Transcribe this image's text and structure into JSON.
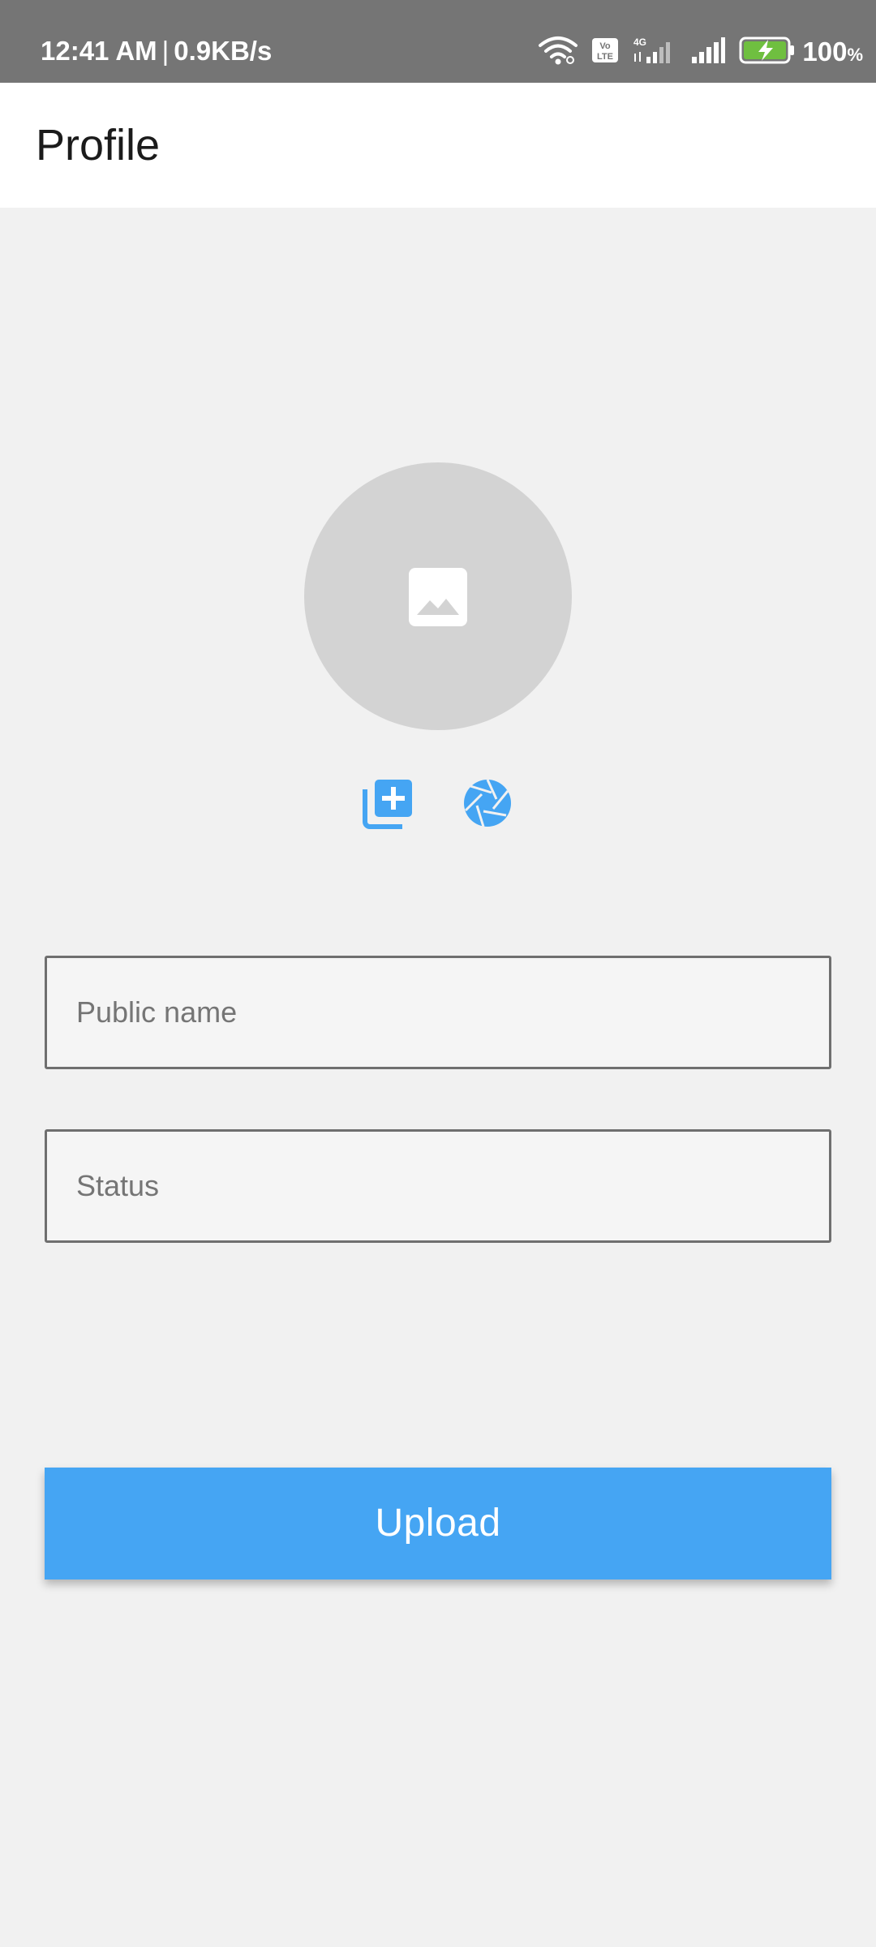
{
  "status_bar": {
    "time": "12:41 AM",
    "separator": "|",
    "speed": "0.9KB/s",
    "volte": "Vo LTE",
    "network": "4G",
    "battery_value": "100",
    "battery_unit": "%",
    "icons": [
      "wifi-icon",
      "volte-icon",
      "signal-icon",
      "signal-icon",
      "battery-charging-icon"
    ]
  },
  "app_bar": {
    "title": "Profile"
  },
  "avatar": {
    "icon": "image-icon"
  },
  "photo_actions": {
    "gallery_icon": "add-photo-library-icon",
    "camera_icon": "camera-shutter-icon"
  },
  "form": {
    "name_placeholder": "Public name",
    "name_value": "",
    "status_placeholder": "Status",
    "status_value": ""
  },
  "upload_button": {
    "label": "Upload"
  },
  "colors": {
    "accent": "#45a5f3",
    "status_bar": "#757575",
    "background": "#f1f1f1",
    "battery_fill": "#6fbf40"
  }
}
